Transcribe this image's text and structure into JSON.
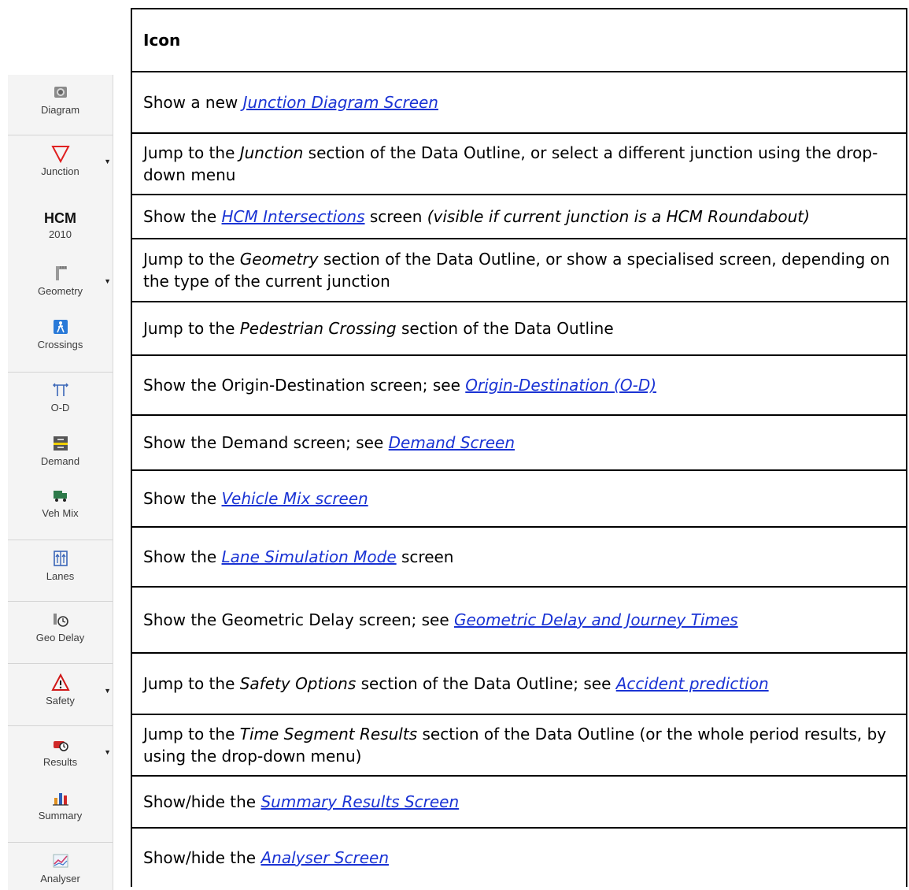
{
  "table": {
    "header": "Icon",
    "rows": [
      {
        "pre": "Show a new ",
        "link": "Junction Diagram Screen",
        "post": ""
      },
      {
        "pre": "Jump to the ",
        "em": "Junction",
        "post": " section of the Data Outline, or select a different junction using the drop-down menu"
      },
      {
        "pre": "Show the ",
        "link": "HCM Intersections",
        "post": " screen ",
        "em2": "(visible if current junction is a HCM Roundabout)"
      },
      {
        "pre": "Jump to the ",
        "em": "Geometry",
        "post": " section of the Data Outline, or show a specialised screen, depending on the type of the current junction"
      },
      {
        "pre": "Jump to the ",
        "em": "Pedestrian Crossing",
        "post": " section of the Data Outline"
      },
      {
        "pre": "Show the Origin-Destination screen; see ",
        "link": "Origin-Destination (O-D)",
        "post": ""
      },
      {
        "pre": "Show the Demand screen; see ",
        "link": "Demand Screen",
        "post": ""
      },
      {
        "pre": "Show the ",
        "link": "Vehicle Mix screen",
        "post": ""
      },
      {
        "pre": "Show the ",
        "link": "Lane Simulation Mode",
        "post": " screen"
      },
      {
        "pre": "Show the Geometric Delay screen; see ",
        "link": "Geometric Delay and Journey Times",
        "post": ""
      },
      {
        "pre": "Jump to the ",
        "em": "Safety Options",
        "post": " section of the Data Outline; see ",
        "link": "Accident prediction"
      },
      {
        "pre": "Jump to the ",
        "em": "Time Segment Results",
        "post": " section of the Data Outline (or the whole period results, by using the drop-down menu)"
      },
      {
        "pre": "Show/hide the ",
        "link": "Summary Results Screen",
        "post": ""
      },
      {
        "pre": "Show/hide the ",
        "link": "Analyser Screen",
        "post": ""
      }
    ]
  },
  "toolbar": {
    "buttons": [
      {
        "label": "Diagram",
        "icon": "camera-icon"
      },
      {
        "label": "Junction",
        "icon": "triangle-icon",
        "dropdown": true
      },
      {
        "label_big": "HCM",
        "label_small": "2010"
      },
      {
        "label": "Geometry",
        "icon": "ruler-icon",
        "dropdown": true
      },
      {
        "label": "Crossings",
        "icon": "pedestrian-icon"
      },
      {
        "label": "O-D",
        "icon": "od-arrows-icon"
      },
      {
        "label": "Demand",
        "icon": "demand-icon"
      },
      {
        "label": "Veh Mix",
        "icon": "truck-icon"
      },
      {
        "label": "Lanes",
        "icon": "lanes-icon"
      },
      {
        "label": "Geo Delay",
        "icon": "geo-delay-icon"
      },
      {
        "label": "Safety",
        "icon": "warning-icon",
        "dropdown": true
      },
      {
        "label": "Results",
        "icon": "results-icon",
        "dropdown": true
      },
      {
        "label": "Summary",
        "icon": "bar-chart-icon"
      },
      {
        "label": "Analyser",
        "icon": "line-chart-icon"
      }
    ],
    "dropdown_glyph": "▼"
  },
  "colors": {
    "link": "#1a33d4",
    "junction_red": "#e02020",
    "crossing_blue": "#2a7ad8"
  }
}
